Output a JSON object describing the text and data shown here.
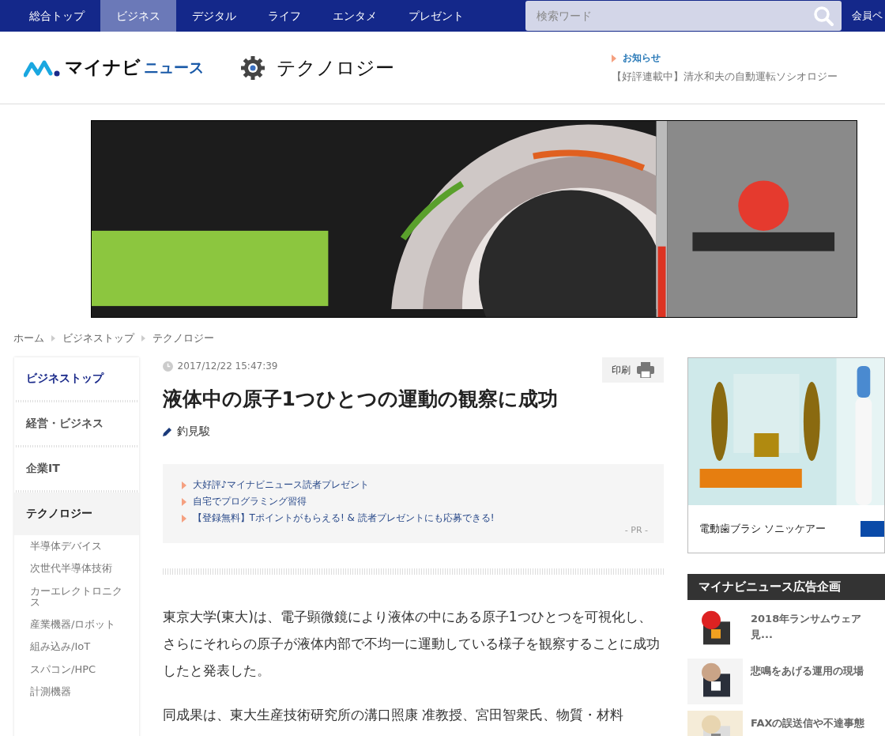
{
  "nav": {
    "items": [
      {
        "label": "総合トップ",
        "selected": false
      },
      {
        "label": "ビジネス",
        "selected": true
      },
      {
        "label": "デジタル",
        "selected": false
      },
      {
        "label": "ライフ",
        "selected": false
      },
      {
        "label": "エンタメ",
        "selected": false
      },
      {
        "label": "プレゼント",
        "selected": false
      }
    ],
    "search": {
      "placeholder": "検索ワード"
    },
    "member_link": "会員ペ"
  },
  "header": {
    "logo_main": "マイナビ",
    "logo_sub": "ニュース",
    "section": "テクノロジー",
    "notice_label": "お知らせ",
    "notice_text": "【好評連載中】清水和夫の自動運転ソシオロジー"
  },
  "breadcrumb": [
    "ホーム",
    "ビジネストップ",
    "テクノロジー"
  ],
  "sidebar": {
    "items": [
      {
        "label": "ビジネストップ",
        "selected": false,
        "kind": "top"
      },
      {
        "label": "経営・ビジネス",
        "selected": false,
        "kind": "section"
      },
      {
        "label": "企業IT",
        "selected": false,
        "kind": "section"
      },
      {
        "label": "テクノロジー",
        "selected": true,
        "kind": "section",
        "children": [
          {
            "label": "半導体デバイス"
          },
          {
            "label": "次世代半導体技術"
          },
          {
            "label": "カーエレクトロニクス"
          },
          {
            "label": "産業機器/ロボット"
          },
          {
            "label": "組み込み/IoT"
          },
          {
            "label": "スパコン/HPC"
          },
          {
            "label": "計測機器"
          }
        ]
      }
    ]
  },
  "article": {
    "date": "2017/12/22 15:47:39",
    "print_label": "印刷",
    "title": "液体中の原子1つひとつの運動の観察に成功",
    "author": "釣見駿",
    "pr_links": [
      "大好評♪マイナビニュース読者プレゼント",
      "自宅でプログラミング習得",
      "【登録無料】Tポイントがもらえる! & 読者プレゼントにも応募できる!"
    ],
    "pr_label": "- PR -",
    "paragraphs": [
      "東京大学(東大)は、電子顕微鏡により液体の中にある原子1つひとつを可視化し、さらにそれらの原子が液体内部で不均一に運動している様子を観察することに成功したと発表した。",
      "同成果は、東大生産技術研究所の溝口照康 准教授、宮田智衆氏、物質・材料"
    ]
  },
  "right": {
    "ad_caption": "電動歯ブラシ ソニッケアー",
    "promo_heading": "マイナビニュース広告企画",
    "promo_items": [
      "2018年ランサムウェア見...",
      "悲鳴をあげる運用の現場",
      "FAXの誤送信や不達事態"
    ]
  }
}
